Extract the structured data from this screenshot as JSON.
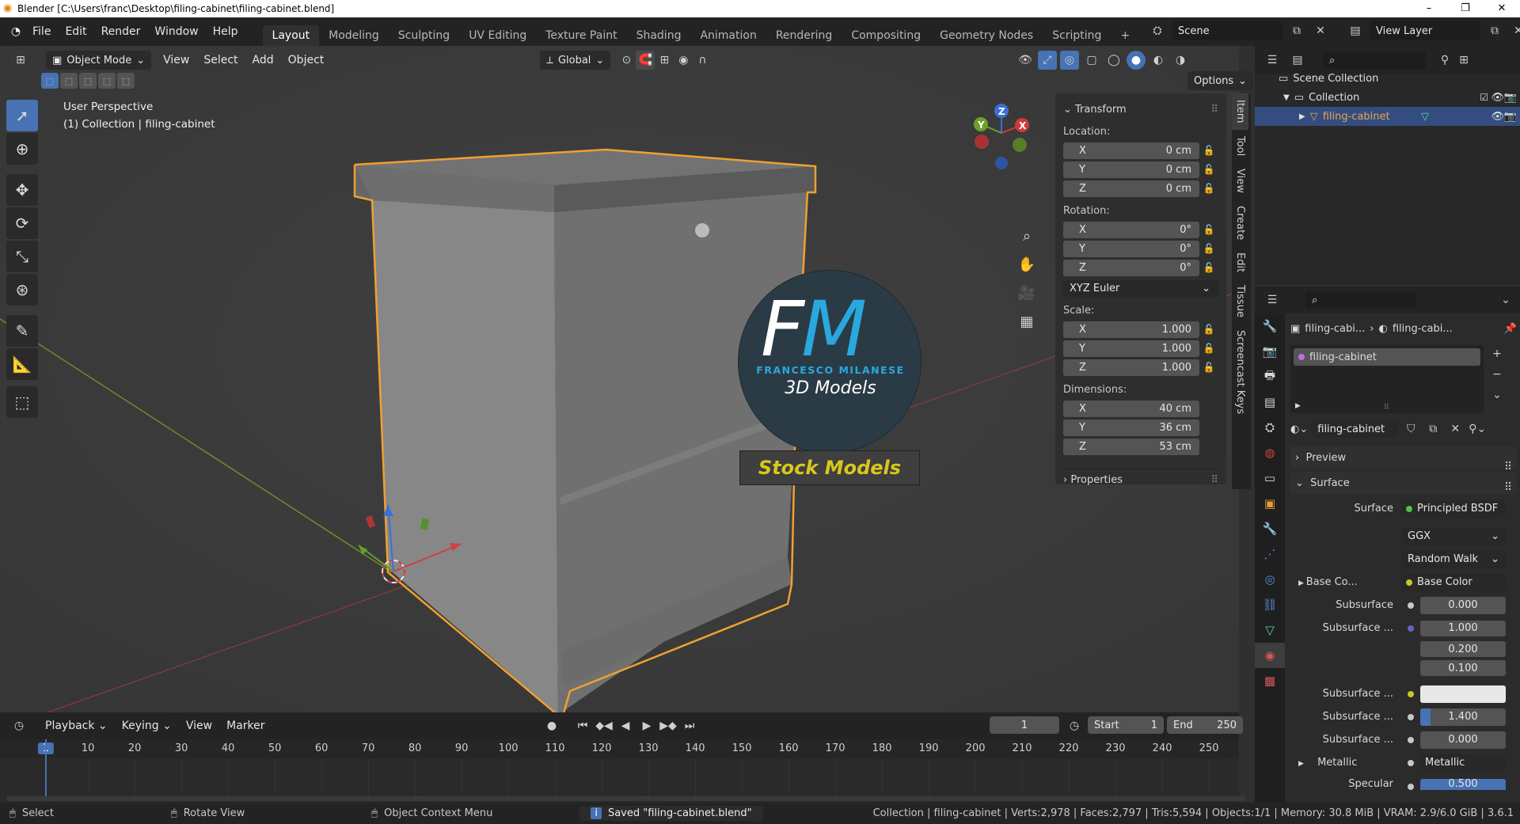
{
  "window": {
    "title": "Blender [C:\\Users\\franc\\Desktop\\filing-cabinet\\filing-cabinet.blend]",
    "min": "–",
    "max": "❐",
    "close": "✕"
  },
  "menu": [
    "File",
    "Edit",
    "Render",
    "Window",
    "Help"
  ],
  "workspaces": [
    "Layout",
    "Modeling",
    "Sculpting",
    "UV Editing",
    "Texture Paint",
    "Shading",
    "Animation",
    "Rendering",
    "Compositing",
    "Geometry Nodes",
    "Scripting"
  ],
  "add_workspace": "+",
  "scene": {
    "name": "Scene",
    "view_layer": "View Layer"
  },
  "viewport": {
    "mode": "Object Mode",
    "menus": [
      "View",
      "Select",
      "Add",
      "Object"
    ],
    "orientation": "Global",
    "options": "Options",
    "overlay_title": "User Perspective",
    "overlay_sub": "(1) Collection | filing-cabinet",
    "gizmo": {
      "x": "X",
      "y": "Y",
      "z": "Z"
    }
  },
  "logo": {
    "letters_f": "F",
    "letters_m": "M",
    "brand": "FRANCESCO MILANESE",
    "sub": "3D Models",
    "banner": "Stock Models"
  },
  "npanel": {
    "header": "Transform",
    "location_label": "Location:",
    "location": [
      {
        "axis": "X",
        "value": "0 cm"
      },
      {
        "axis": "Y",
        "value": "0 cm"
      },
      {
        "axis": "Z",
        "value": "0 cm"
      }
    ],
    "rotation_label": "Rotation:",
    "rotation": [
      {
        "axis": "X",
        "value": "0°"
      },
      {
        "axis": "Y",
        "value": "0°"
      },
      {
        "axis": "Z",
        "value": "0°"
      }
    ],
    "rotation_mode": "XYZ Euler",
    "scale_label": "Scale:",
    "scale": [
      {
        "axis": "X",
        "value": "1.000"
      },
      {
        "axis": "Y",
        "value": "1.000"
      },
      {
        "axis": "Z",
        "value": "1.000"
      }
    ],
    "dimensions_label": "Dimensions:",
    "dimensions": [
      {
        "axis": "X",
        "value": "40 cm"
      },
      {
        "axis": "Y",
        "value": "36 cm"
      },
      {
        "axis": "Z",
        "value": "53 cm"
      }
    ],
    "properties": "Properties",
    "tabs": [
      "Item",
      "Tool",
      "View",
      "Create",
      "Edit",
      "Tissue",
      "Screencast Keys"
    ]
  },
  "outliner": {
    "scene_collection": "Scene Collection",
    "collection": "Collection",
    "object": "filing-cabinet"
  },
  "properties": {
    "breadcrumb_object": "filing-cabi...",
    "breadcrumb_material": "filing-cabi...",
    "slot": "filing-cabinet",
    "material_name": "filing-cabinet",
    "preview": "Preview",
    "surface_panel": "Surface",
    "rows": [
      {
        "label": "Surface",
        "value": "Principled BSDF",
        "sock": "#4fbf4f"
      },
      {
        "label": "",
        "value": "GGX",
        "sock": ""
      },
      {
        "label": "",
        "value": "Random Walk",
        "sock": ""
      },
      {
        "label": "Base Co...",
        "value": "Base Color",
        "sock": "#c7c729"
      },
      {
        "label": "Subsurface",
        "value": "0.000",
        "sock": "#a1a1a1"
      },
      {
        "label": "Subsurface ...",
        "value": "1.000",
        "sock": "#6363c7"
      },
      {
        "label": "",
        "value": "0.200",
        "sock": ""
      },
      {
        "label": "",
        "value": "0.100",
        "sock": ""
      },
      {
        "label": "Subsurface ...",
        "value": "",
        "sock": "#c7c729"
      },
      {
        "label": "Subsurface ...",
        "value": "1.400",
        "sock": "#a1a1a1"
      },
      {
        "label": "Subsurface ...",
        "value": "0.000",
        "sock": "#a1a1a1"
      },
      {
        "label": "Metallic",
        "value": "Metallic",
        "sock": "#a1a1a1"
      },
      {
        "label": "Specular",
        "value": "0.500",
        "sock": "#a1a1a1"
      }
    ]
  },
  "timeline": {
    "menus": [
      "Playback",
      "Keying",
      "View",
      "Marker"
    ],
    "current_frame": "1",
    "start_label": "Start",
    "start": "1",
    "end_label": "End",
    "end": "250",
    "ticks": [
      "1",
      "10",
      "20",
      "30",
      "40",
      "50",
      "60",
      "70",
      "80",
      "90",
      "100",
      "110",
      "120",
      "130",
      "140",
      "150",
      "160",
      "170",
      "180",
      "190",
      "200",
      "210",
      "220",
      "230",
      "240",
      "250"
    ]
  },
  "status": {
    "select": "Select",
    "rotate": "Rotate View",
    "context": "Object Context Menu",
    "message": "Saved \"filing-cabinet.blend\"",
    "stats": "Collection | filing-cabinet | Verts:2,978 | Faces:2,797 | Tris:5,594 | Objects:1/1 | Memory: 30.8 MiB | VRAM: 2.9/6.0 GiB | 3.6.1"
  }
}
